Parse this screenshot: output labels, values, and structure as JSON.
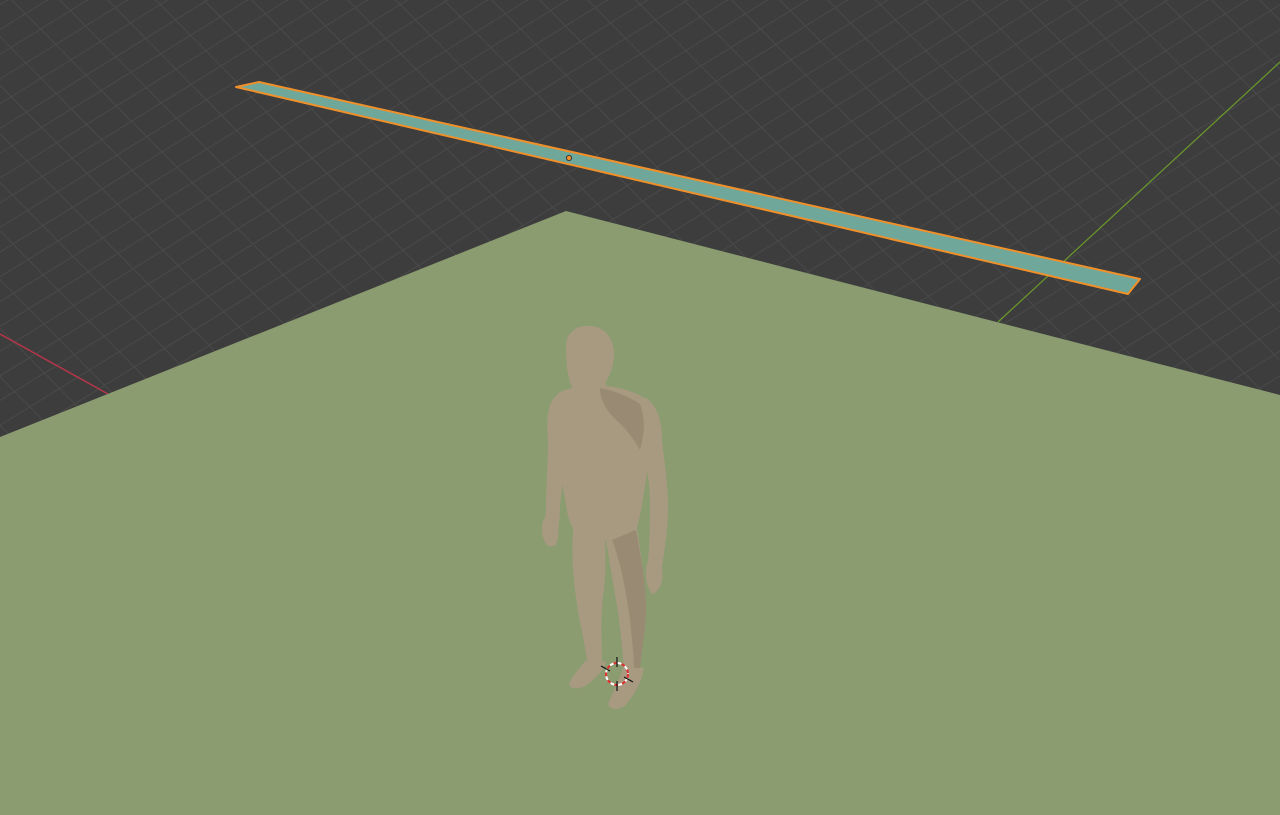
{
  "app": {
    "name": "3D Viewport",
    "mode": "object-mode",
    "view": "perspective"
  },
  "colors": {
    "viewport_background": "#3d3d3d",
    "grid_line": "#4a4a4a",
    "grid_line_major": "#525252",
    "x_axis": "#b5364a",
    "y_axis": "#6a9a2a",
    "ground_plane": "#8a9c70",
    "selected_plane_fill": "#6fa89a",
    "selection_outline": "#f0902a",
    "figure_skin": "#a89a80",
    "figure_shadow": "#7d715c",
    "cursor_red": "#e03030",
    "cursor_white": "#ffffff"
  },
  "scene": {
    "objects": [
      {
        "name": "ground-plane",
        "selected": false
      },
      {
        "name": "thin-strip-plane",
        "selected": true
      },
      {
        "name": "human-figure",
        "selected": false
      }
    ],
    "cursor": {
      "name": "3d-cursor",
      "icon": "crosshair-circle-icon"
    },
    "origin_marker": {
      "name": "object-origin-dot"
    }
  }
}
